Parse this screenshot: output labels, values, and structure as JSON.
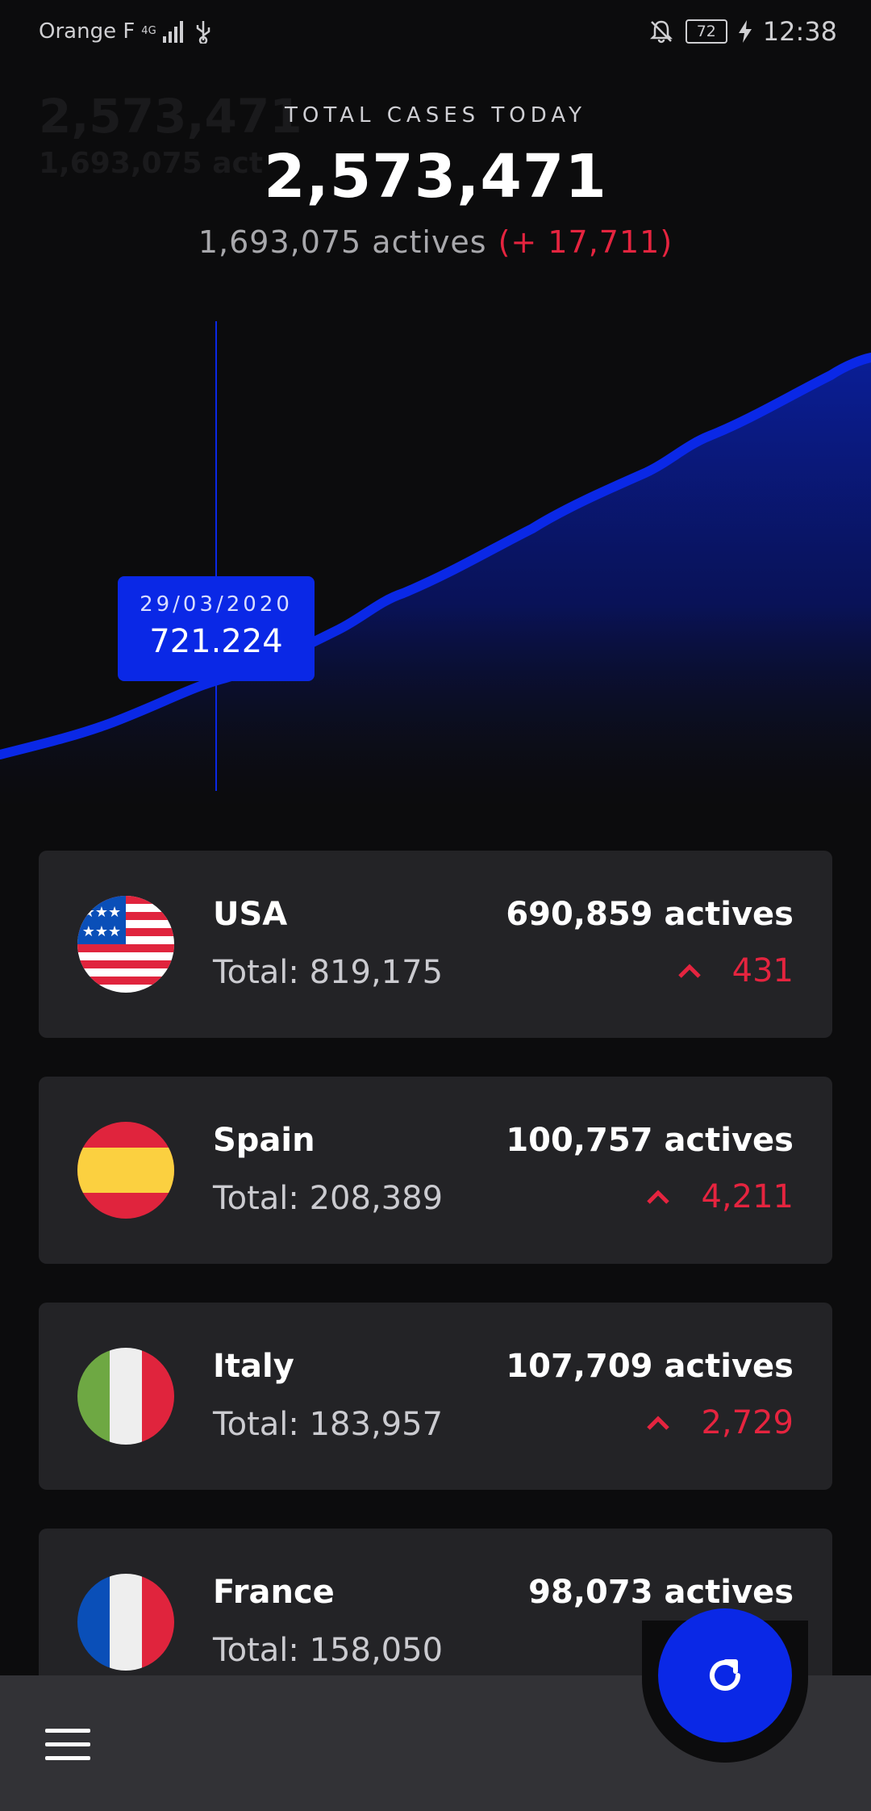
{
  "status_bar": {
    "carrier": "Orange F",
    "network": "4G",
    "battery": "72",
    "time": "12:38"
  },
  "header": {
    "label": "TOTAL CASES TODAY",
    "total_cases": "2,573,471",
    "actives": "1,693,075 actives",
    "actives_delta": "(+ 17,711)"
  },
  "ghost_text": {
    "line1": "2,573,471",
    "line2": "1,693,075 act"
  },
  "chart_data": {
    "type": "area",
    "title": "",
    "color": "#0a28e6",
    "tooltip": {
      "date": "29/03/2020",
      "value": "721.224"
    }
  },
  "countries": [
    {
      "name": "USA",
      "total": "Total: 819,175",
      "actives": "690,859 actives",
      "change": "431",
      "flag": "usa-flag"
    },
    {
      "name": "Spain",
      "total": "Total: 208,389",
      "actives": "100,757 actives",
      "change": "4,211",
      "flag": "spain-flag"
    },
    {
      "name": "Italy",
      "total": "Total: 183,957",
      "actives": "107,709 actives",
      "change": "2,729",
      "flag": "italy-flag"
    },
    {
      "name": "France",
      "total": "Total: 158,050",
      "actives": "98,073 actives",
      "change": "",
      "flag": "france-flag"
    }
  ],
  "colors": {
    "accent": "#0a28e6",
    "increase": "#e5243f",
    "card": "#232326",
    "background": "#0c0c0d"
  },
  "icons": {
    "menu": "menu-icon",
    "refresh": "refresh-icon"
  }
}
